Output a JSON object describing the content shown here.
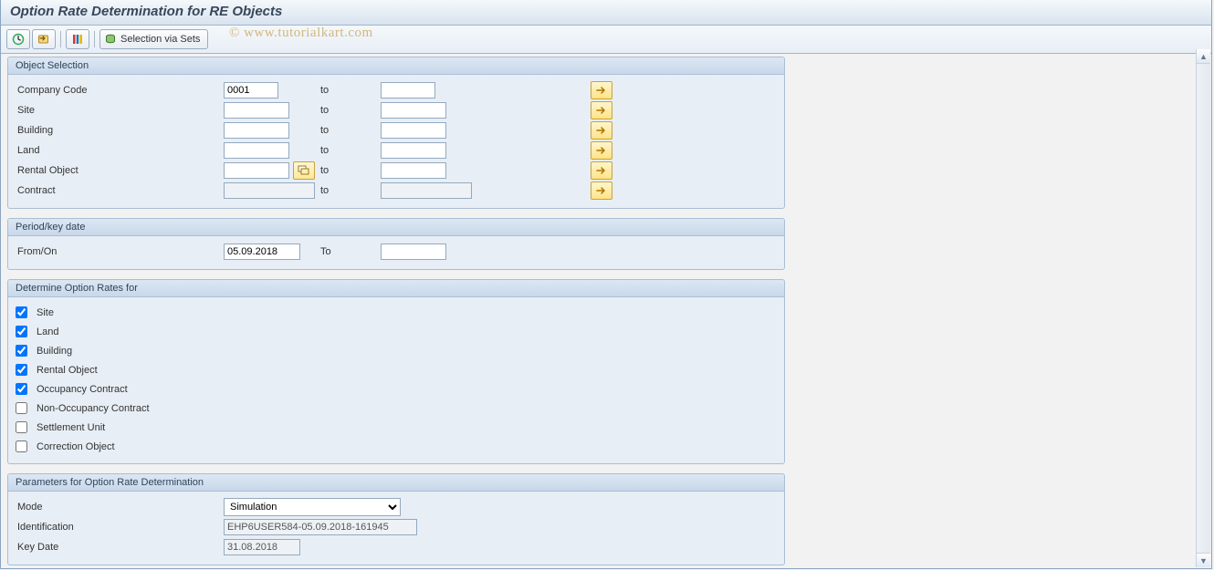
{
  "title": "Option Rate Determination for RE Objects",
  "toolbar": {
    "exec_label": "",
    "variant_label": "",
    "select_all_label": "",
    "selection_via_sets_label": "Selection via Sets"
  },
  "watermark": "© www.tutorialkart.com",
  "groups": {
    "object_selection": {
      "title": "Object Selection",
      "rows": {
        "company_code": {
          "label": "Company Code",
          "from": "0001",
          "to": ""
        },
        "site": {
          "label": "Site",
          "from": "",
          "to": ""
        },
        "building": {
          "label": "Building",
          "from": "",
          "to": ""
        },
        "land": {
          "label": "Land",
          "from": "",
          "to": ""
        },
        "rental_object": {
          "label": "Rental Object",
          "from": "",
          "to": ""
        },
        "contract": {
          "label": "Contract",
          "from": "",
          "to": ""
        }
      },
      "to_label": "to"
    },
    "period_key_date": {
      "title": "Period/key date",
      "from_on_label": "From/On",
      "from_on_value": "05.09.2018",
      "to_label": "To",
      "to_value": ""
    },
    "determine_for": {
      "title": "Determine Option Rates for",
      "items": [
        {
          "label": "Site",
          "checked": true
        },
        {
          "label": "Land",
          "checked": true
        },
        {
          "label": "Building",
          "checked": true
        },
        {
          "label": "Rental Object",
          "checked": true
        },
        {
          "label": "Occupancy Contract",
          "checked": true
        },
        {
          "label": "Non-Occupancy Contract",
          "checked": false
        },
        {
          "label": "Settlement Unit",
          "checked": false
        },
        {
          "label": "Correction Object",
          "checked": false
        }
      ]
    },
    "parameters": {
      "title": "Parameters for Option Rate Determination",
      "mode_label": "Mode",
      "mode_value": "Simulation",
      "identification_label": "Identification",
      "identification_value": "EHP6USER584-05.09.2018-161945",
      "key_date_label": "Key Date",
      "key_date_value": "31.08.2018"
    }
  }
}
